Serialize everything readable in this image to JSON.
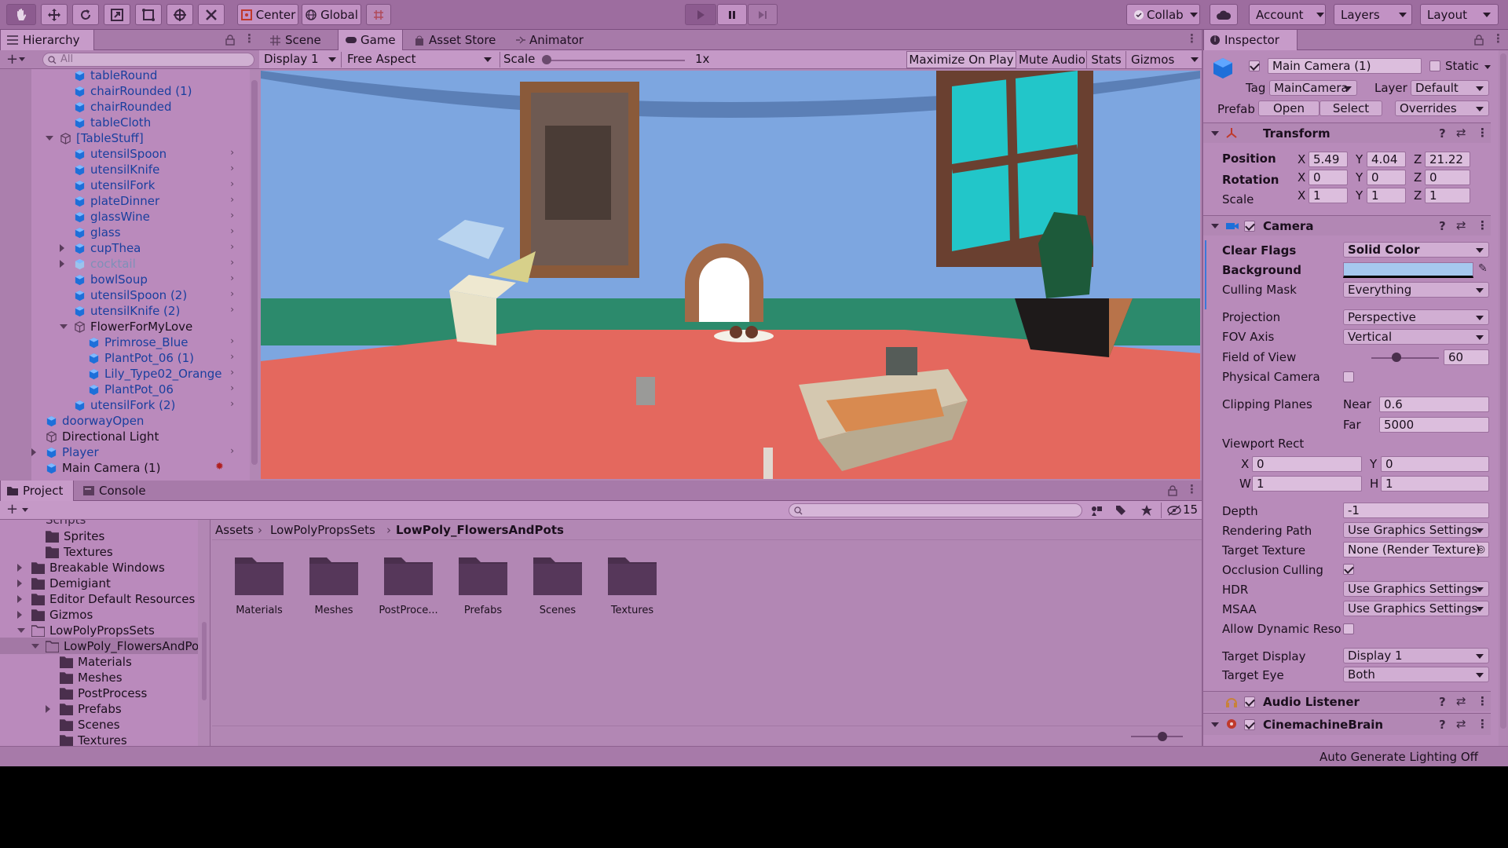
{
  "toolbar": {
    "pivot_center": "Center",
    "pivot_global": "Global",
    "collab": "Collab",
    "account": "Account",
    "layers": "Layers",
    "layout": "Layout"
  },
  "hierarchy": {
    "tab": "Hierarchy",
    "search_placeholder": "All",
    "items": [
      {
        "label": "tableRound"
      },
      {
        "label": "chairRounded (1)"
      },
      {
        "label": "chairRounded"
      },
      {
        "label": "tableCloth"
      },
      {
        "label": "[TableStuff]"
      },
      {
        "label": "utensilSpoon"
      },
      {
        "label": "utensilKnife"
      },
      {
        "label": "utensilFork"
      },
      {
        "label": "plateDinner"
      },
      {
        "label": "glassWine"
      },
      {
        "label": "glass"
      },
      {
        "label": "cupThea"
      },
      {
        "label": "cocktail"
      },
      {
        "label": "bowlSoup"
      },
      {
        "label": "utensilSpoon (2)"
      },
      {
        "label": "utensilKnife (2)"
      },
      {
        "label": "FlowerForMyLove"
      },
      {
        "label": "Primrose_Blue"
      },
      {
        "label": "PlantPot_06 (1)"
      },
      {
        "label": "Lily_Type02_Orange"
      },
      {
        "label": "PlantPot_06"
      },
      {
        "label": "utensilFork (2)"
      },
      {
        "label": "doorwayOpen"
      },
      {
        "label": "Directional Light"
      },
      {
        "label": "Player"
      },
      {
        "label": "Main Camera (1)"
      }
    ]
  },
  "game": {
    "tabs": [
      "Scene",
      "Game",
      "Asset Store",
      "Animator"
    ],
    "display": "Display 1",
    "aspect": "Free Aspect",
    "scale_label": "Scale",
    "scale_value": "1x",
    "maximize": "Maximize On Play",
    "mute": "Mute Audio",
    "stats": "Stats",
    "gizmos": "Gizmos"
  },
  "project": {
    "tabs": [
      "Project",
      "Console"
    ],
    "hidden_count": "15",
    "breadcrumb": [
      "Assets",
      "LowPolyPropsSets",
      "LowPoly_FlowersAndPots"
    ],
    "tree": [
      {
        "label": "Sprites"
      },
      {
        "label": "Textures"
      },
      {
        "label": "Breakable Windows"
      },
      {
        "label": "Demigiant"
      },
      {
        "label": "Editor Default Resources"
      },
      {
        "label": "Gizmos"
      },
      {
        "label": "LowPolyPropsSets"
      },
      {
        "label": "LowPoly_FlowersAndPo"
      },
      {
        "label": "Materials"
      },
      {
        "label": "Meshes"
      },
      {
        "label": "PostProcess"
      },
      {
        "label": "Prefabs"
      },
      {
        "label": "Scenes"
      },
      {
        "label": "Textures"
      }
    ],
    "folders": [
      "Materials",
      "Meshes",
      "PostProce...",
      "Prefabs",
      "Scenes",
      "Textures"
    ]
  },
  "inspector": {
    "tab": "Inspector",
    "object_name": "Main Camera (1)",
    "static_label": "Static",
    "tag_label": "Tag",
    "tag_value": "MainCamera",
    "layer_label": "Layer",
    "layer_value": "Default",
    "prefab_label": "Prefab",
    "open": "Open",
    "select": "Select",
    "overrides": "Overrides",
    "transform": {
      "title": "Transform",
      "position_label": "Position",
      "rotation_label": "Rotation",
      "scale_label": "Scale",
      "pos": {
        "x": "5.49",
        "y": "4.04",
        "z": "21.22"
      },
      "rot": {
        "x": "0",
        "y": "0",
        "z": "0"
      },
      "scl": {
        "x": "1",
        "y": "1",
        "z": "1"
      }
    },
    "camera": {
      "title": "Camera",
      "clear_flags_label": "Clear Flags",
      "clear_flags": "Solid Color",
      "background_label": "Background",
      "background_color": "#a6c8ef",
      "culling_mask_label": "Culling Mask",
      "culling_mask": "Everything",
      "projection_label": "Projection",
      "projection": "Perspective",
      "fov_axis_label": "FOV Axis",
      "fov_axis": "Vertical",
      "fov_label": "Field of View",
      "fov": "60",
      "fov_slider_fraction": 0.37,
      "physical_label": "Physical Camera",
      "clipping_label": "Clipping Planes",
      "near_label": "Near",
      "near": "0.6",
      "far_label": "Far",
      "far": "5000",
      "viewport_label": "Viewport Rect",
      "vx": "0",
      "vy": "0",
      "vw": "1",
      "vh": "1",
      "depth_label": "Depth",
      "depth": "-1",
      "rendering_path_label": "Rendering Path",
      "rendering_path": "Use Graphics Settings",
      "target_texture_label": "Target Texture",
      "target_texture": "None (Render Texture)",
      "occlusion_label": "Occlusion Culling",
      "hdr_label": "HDR",
      "hdr": "Use Graphics Settings",
      "msaa_label": "MSAA",
      "msaa": "Use Graphics Settings",
      "dynres_label": "Allow Dynamic Reso",
      "target_display_label": "Target Display",
      "target_display": "Display 1",
      "target_eye_label": "Target Eye",
      "target_eye": "Both"
    },
    "audio_listener": "Audio Listener",
    "cinemachine": "CinemachineBrain"
  },
  "status": {
    "lighting": "Auto Generate Lighting Off"
  },
  "colors": {
    "editor_bg": "#b07fb1",
    "toolbar_bg": "#9d6d9f",
    "selection_blue": "#2a6bd3",
    "wall_blue": "#7da6e0",
    "floor_red": "#e4685e",
    "floor_green": "#2c8a6c"
  }
}
